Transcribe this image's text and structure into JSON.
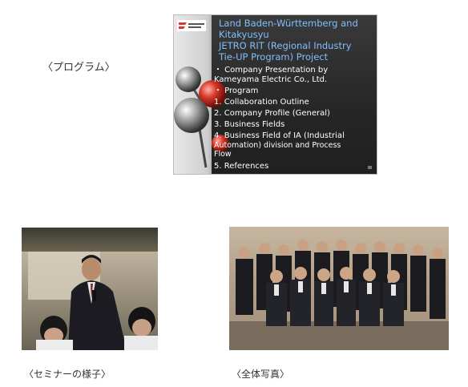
{
  "labels": {
    "program": "〈プログラム〉",
    "seminar": "〈セミナーの様子〉",
    "group": "〈全体写真〉"
  },
  "slide": {
    "logo_text": "KAMEYAMA ELECTRIC",
    "title_lines": [
      "Land Baden-Württemberg  and",
      "Kitakyusyu",
      "JETRO RIT (Regional Industry",
      "Tie-UP Program) Project"
    ],
    "bullets": [
      "・ Company Presentation by",
      "    Kameyama Electric Co., Ltd.",
      "・ Program"
    ],
    "items": [
      "1. Collaboration  Outline",
      "2. Company Profile (General)",
      "3. Business Fields",
      "4. Business Field of IA (Industrial",
      "    Automation) division and Process",
      "    Flow",
      "5. References"
    ]
  },
  "colors": {
    "slide_title": "#7fbfff",
    "slide_text": "#ffffff"
  }
}
